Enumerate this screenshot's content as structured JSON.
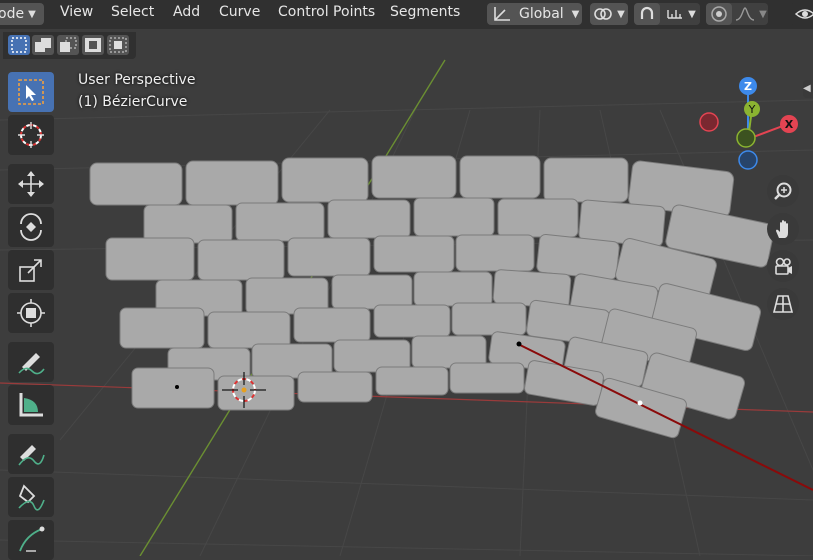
{
  "header": {
    "mode_label": "ode",
    "menus": [
      "View",
      "Select",
      "Add",
      "Curve",
      "Control Points",
      "Segments"
    ],
    "transform_orientation": "Global"
  },
  "viewport": {
    "perspective_label": "User Perspective",
    "object_label": "(1) BézierCurve"
  },
  "gizmo": {
    "z_label": "Z",
    "y_label": "Y",
    "x_label": "X",
    "colors": {
      "x": "#e34452",
      "y": "#8bb331",
      "z": "#3d8aeb"
    }
  },
  "icons": {
    "select_box": "select-box-icon",
    "cursor": "3d-cursor-icon",
    "move": "move-icon",
    "rotate": "rotate-icon",
    "scale": "scale-icon",
    "transform": "transform-icon",
    "annotate": "annotate-icon",
    "measure": "measure-icon",
    "draw": "curve-draw-icon",
    "pen": "curve-pen-icon",
    "tilt": "curve-tilt-icon",
    "zoom": "zoom-icon",
    "pan": "pan-hand-icon",
    "camera": "camera-icon",
    "grid": "perspective-grid-icon"
  }
}
